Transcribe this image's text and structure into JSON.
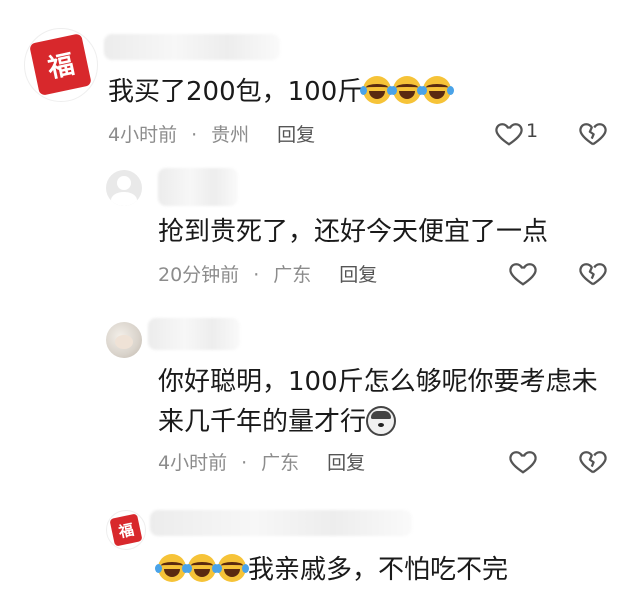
{
  "comments": [
    {
      "text": "我买了200包，100斤",
      "emoji_trailing": [
        "tears-of-joy-emoji",
        "tears-of-joy-emoji",
        "tears-of-joy-emoji"
      ],
      "time": "4小时前",
      "sep": "·",
      "location": "贵州",
      "reply": "回复",
      "likes": "1",
      "avatar": "fu-seal-avatar"
    },
    {
      "text": "抢到贵死了，还好今天便宜了一点",
      "time": "20分钟前",
      "sep": "·",
      "location": "广东",
      "reply": "回复",
      "avatar": "default-avatar"
    },
    {
      "text": "你好聪明，100斤怎么够呢你要考虑未来几千年的量才行",
      "emoji_trailing": [
        "husky-emoji"
      ],
      "time": "4小时前",
      "sep": "·",
      "location": "广东",
      "reply": "回复",
      "avatar": "photo-avatar"
    },
    {
      "emoji_leading": [
        "tears-of-joy-emoji",
        "tears-of-joy-emoji",
        "tears-of-joy-emoji"
      ],
      "text": "我亲戚多，不怕吃不完",
      "avatar": "fu-seal-avatar"
    }
  ],
  "fu_glyph": "福",
  "colors": {
    "meta_text": "#8c8c8c",
    "body_text": "#1a1a1a",
    "seal_red": "#d8282c"
  }
}
